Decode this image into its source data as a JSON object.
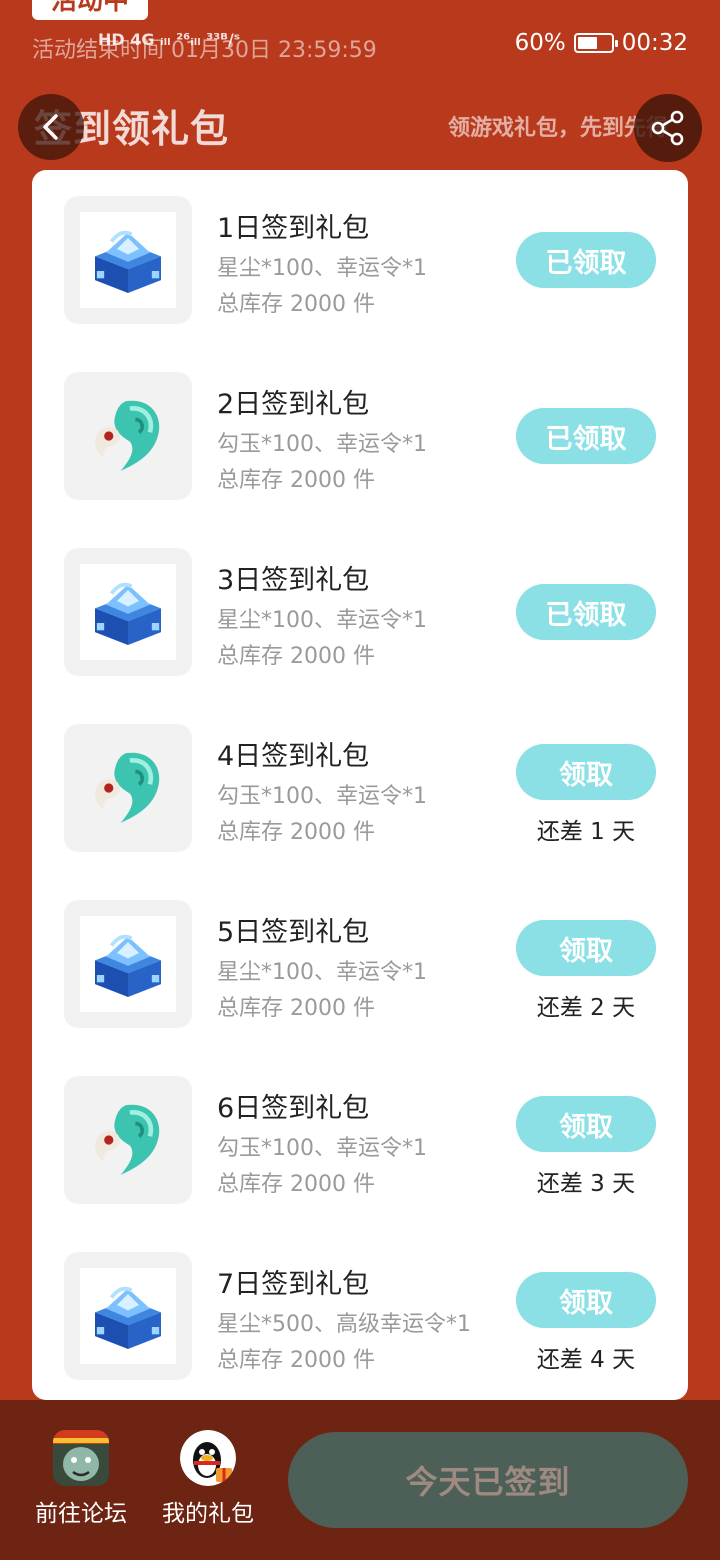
{
  "status_bar": {
    "net_indicators": "HD 4G ᵢₗₗ ²⁶ᵢₗₗ ³³ᴮ/ˢ",
    "battery": "60%",
    "battery_level": 0.6,
    "time": "00:32"
  },
  "activity": {
    "badge": "活动中",
    "end_time": "活动结束时间 01月30日 23:59:59"
  },
  "header": {
    "title": "签到领礼包",
    "subtitle": "领游戏礼包，先到先得"
  },
  "gifts": [
    {
      "name": "1日签到礼包",
      "desc": "星尘*100、幸运令*1",
      "stock": "总库存 2000 件",
      "button": "已领取",
      "remain": "",
      "icon": "crystal-chest-icon"
    },
    {
      "name": "2日签到礼包",
      "desc": "勾玉*100、幸运令*1",
      "stock": "总库存 2000 件",
      "button": "已领取",
      "remain": "",
      "icon": "jade-magatama-icon"
    },
    {
      "name": "3日签到礼包",
      "desc": "星尘*100、幸运令*1",
      "stock": "总库存 2000 件",
      "button": "已领取",
      "remain": "",
      "icon": "crystal-chest-icon"
    },
    {
      "name": "4日签到礼包",
      "desc": "勾玉*100、幸运令*1",
      "stock": "总库存 2000 件",
      "button": "领取",
      "remain": "还差 1 天",
      "icon": "jade-magatama-icon"
    },
    {
      "name": "5日签到礼包",
      "desc": "星尘*100、幸运令*1",
      "stock": "总库存 2000 件",
      "button": "领取",
      "remain": "还差 2 天",
      "icon": "crystal-chest-icon"
    },
    {
      "name": "6日签到礼包",
      "desc": "勾玉*100、幸运令*1",
      "stock": "总库存 2000 件",
      "button": "领取",
      "remain": "还差 3 天",
      "icon": "jade-magatama-icon"
    },
    {
      "name": "7日签到礼包",
      "desc": "星尘*500、高级幸运令*1",
      "stock": "总库存 2000 件",
      "button": "领取",
      "remain": "还差 4 天",
      "icon": "crystal-chest-icon"
    }
  ],
  "bottom_nav": {
    "forum_label": "前往论坛",
    "my_gifts_label": "我的礼包",
    "signed_button": "今天已签到"
  },
  "colors": {
    "background": "#b8391c",
    "button_accent": "#8be0e6",
    "bottom_bar": "#6e2413",
    "signed_button": "#4d6058"
  }
}
